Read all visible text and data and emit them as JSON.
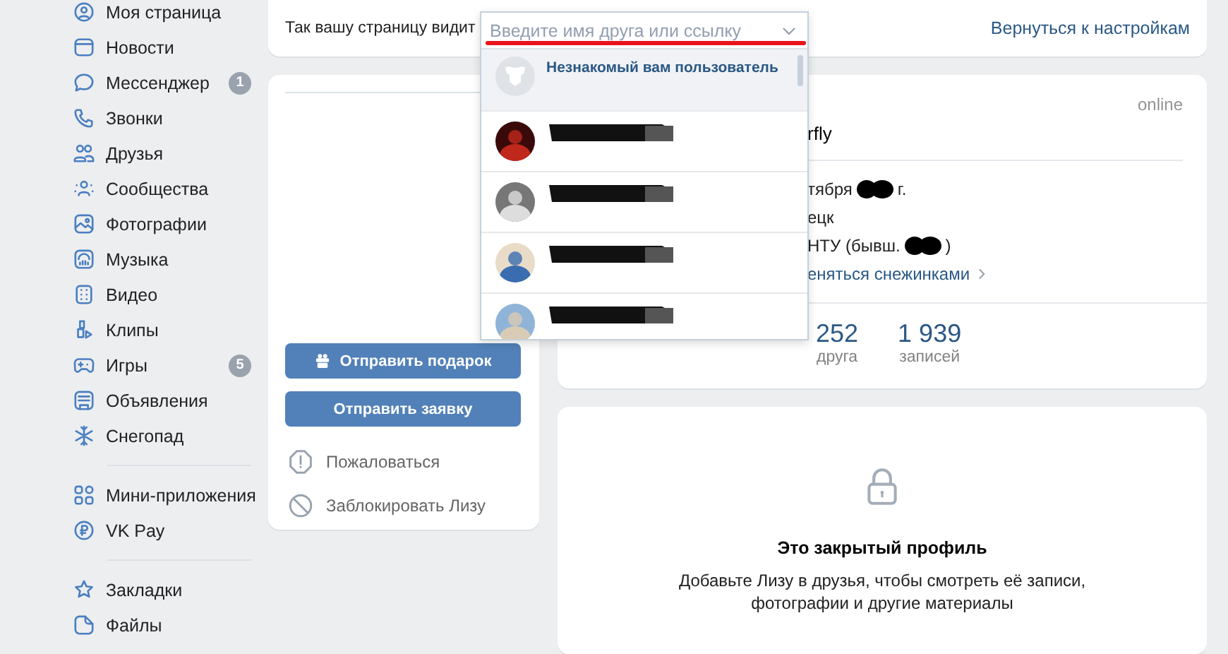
{
  "sidebar": {
    "groups": [
      [
        {
          "label": "Моя страница"
        },
        {
          "label": "Новости"
        },
        {
          "label": "Мессенджер",
          "badge": "1"
        },
        {
          "label": "Звонки"
        },
        {
          "label": "Друзья"
        },
        {
          "label": "Сообщества"
        },
        {
          "label": "Фотографии"
        },
        {
          "label": "Музыка"
        },
        {
          "label": "Видео"
        },
        {
          "label": "Клипы"
        },
        {
          "label": "Игры",
          "badge": "5"
        },
        {
          "label": "Объявления"
        },
        {
          "label": "Снегопад"
        }
      ],
      [
        {
          "label": "Мини-приложения"
        },
        {
          "label": "VK Pay"
        }
      ],
      [
        {
          "label": "Закладки"
        },
        {
          "label": "Файлы"
        }
      ]
    ]
  },
  "viewer_bar": {
    "label": "Так вашу страницу видит",
    "search": {
      "placeholder": "Введите имя друга или ссылку"
    },
    "back_link": "Вернуться к настройкам"
  },
  "dropdown": {
    "items": [
      {
        "kind": "default",
        "name": "Незнакомый вам пользователь",
        "selected": true
      },
      {
        "kind": "redacted",
        "selected": false
      },
      {
        "kind": "redacted",
        "selected": false
      },
      {
        "kind": "redacted",
        "selected": false
      },
      {
        "kind": "redacted",
        "selected": false
      }
    ]
  },
  "profile": {
    "buttons": [
      "Отправить подарок",
      "Отправить заявку"
    ],
    "links": [
      "Пожаловаться",
      "Заблокировать Лизу"
    ],
    "status": "online",
    "name_fragment": "rfly",
    "info": [
      {
        "kind": "text",
        "text": "тября",
        "redacted": true,
        "after": "г."
      },
      {
        "kind": "text",
        "text": "ецк",
        "redacted": false
      },
      {
        "kind": "text",
        "text": "НТУ (бывш.",
        "redacted": true,
        "after": ")"
      },
      {
        "kind": "link",
        "text": "еняться снежинками",
        "redacted": false
      }
    ],
    "counters": [
      {
        "value": "252",
        "label": "друга"
      },
      {
        "value": "1 939",
        "label": "записей"
      }
    ],
    "closed": {
      "title": "Это закрытый профиль",
      "text": "Добавьте Лизу в друзья, чтобы смотреть её записи,\nфотографии и другие материалы"
    }
  }
}
